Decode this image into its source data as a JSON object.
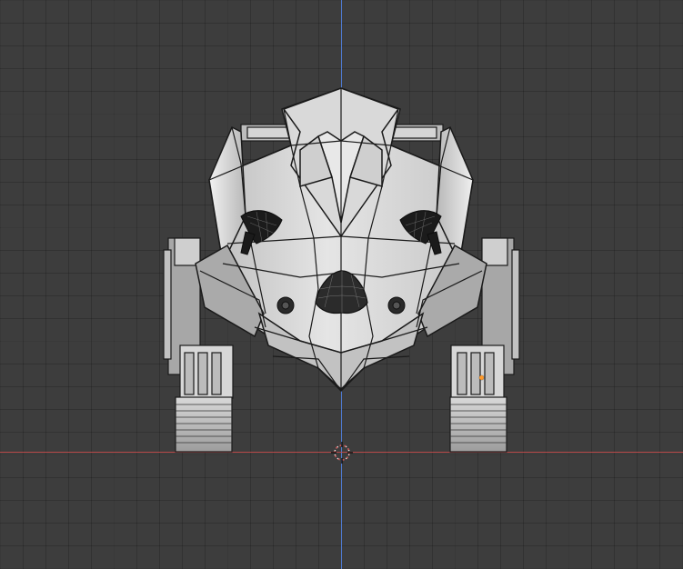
{
  "viewport": {
    "view_name": "front-orthographic-3d-view",
    "object": "robot-creature-mesh-wireframe-overlay",
    "colors": {
      "background": "#3d3d3d",
      "grid_minor": "#343434",
      "grid_major": "#474747",
      "x_axis": "#c64a4a",
      "y_axis": "#4f7cd6",
      "mesh_light": "#d8d8d8",
      "mesh_mid": "#b5b5b5",
      "mesh_dark": "#6d6d6d",
      "wire": "#1a1a1a",
      "origin": "#ff9a2b"
    }
  },
  "overlays": {
    "cursor_icon": "3d-cursor-icon",
    "origin_icon": "object-origin-dot"
  }
}
